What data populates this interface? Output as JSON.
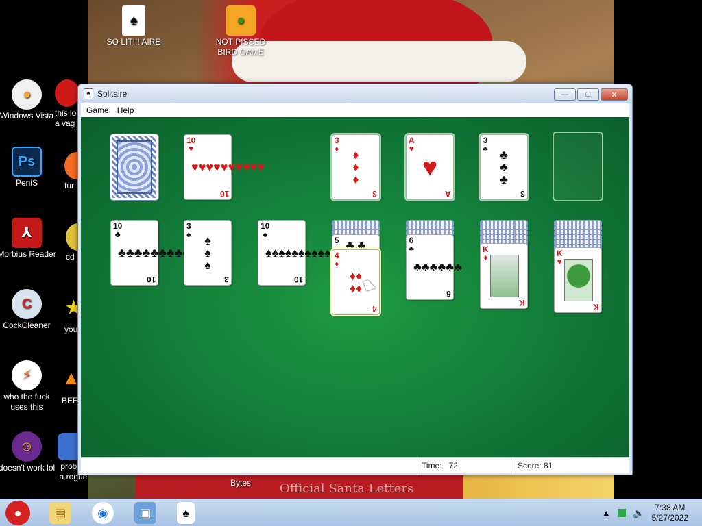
{
  "desktop": {
    "top_icons": [
      {
        "label": "SO LIT!!! AIRE"
      },
      {
        "label": "NOT PISSED BIRD GAME"
      }
    ],
    "left_icons": [
      {
        "label": "Windows Vista"
      },
      {
        "label": "PeniS"
      },
      {
        "label": "Morbius Reader"
      },
      {
        "label": "CockCleaner"
      },
      {
        "label": "who the fuck uses this"
      },
      {
        "label": "doesn't work lol"
      }
    ],
    "second_col_icons": [
      {
        "label": "this lo a vag"
      },
      {
        "label": "fur"
      },
      {
        "label": "cd"
      },
      {
        "label": "you"
      },
      {
        "label": "BEEF"
      },
      {
        "label": "probab a rogue"
      }
    ],
    "bottom_label": "Bytes",
    "wallpaper_text": "Official Santa Letters"
  },
  "window": {
    "title": "Solitaire",
    "menu": [
      "Game",
      "Help"
    ],
    "buttons": {
      "minimize": "—",
      "maximize": "□",
      "close": "✕"
    }
  },
  "game": {
    "stock": {
      "type": "back"
    },
    "waste": {
      "rank": "10",
      "suit": "♥",
      "color": "red"
    },
    "foundations": [
      {
        "rank": "3",
        "suit": "♦",
        "color": "red"
      },
      {
        "rank": "A",
        "suit": "♥",
        "color": "red"
      },
      {
        "rank": "3",
        "suit": "♣",
        "color": "black"
      },
      {
        "rank": "",
        "suit": "",
        "color": "empty"
      }
    ],
    "tableau": [
      {
        "cards": [
          {
            "rank": "10",
            "suit": "♣",
            "color": "black"
          }
        ]
      },
      {
        "cards": [
          {
            "rank": "3",
            "suit": "♠",
            "color": "black"
          }
        ]
      },
      {
        "cards": [
          {
            "rank": "10",
            "suit": "♠",
            "color": "black"
          }
        ]
      },
      {
        "hidden": 3,
        "cards": [
          {
            "rank": "5",
            "suit": "♣",
            "color": "black"
          },
          {
            "rank": "4",
            "suit": "♦",
            "color": "red"
          }
        ]
      },
      {
        "hidden": 3,
        "cards": [
          {
            "rank": "6",
            "suit": "♣",
            "color": "black"
          }
        ]
      },
      {
        "hidden": 5,
        "cards": [
          {
            "rank": "K",
            "suit": "♦",
            "color": "red"
          }
        ]
      },
      {
        "hidden": 6,
        "cards": [
          {
            "rank": "K",
            "suit": "♥",
            "color": "red"
          }
        ]
      }
    ]
  },
  "status": {
    "time_label": "Time:",
    "time_value": "72",
    "score_label": "Score:",
    "score_value": "81"
  },
  "taskbar": {
    "items": [
      "angry-bird-icon",
      "folder-icon",
      "chrome-icon",
      "picture-icon",
      "solitaire-icon"
    ],
    "clock_time": "7:38 AM",
    "clock_date": "5/27/2022"
  },
  "colors": {
    "felt": "#13803a",
    "red_suit": "#d11a1a",
    "black_suit": "#111111"
  }
}
